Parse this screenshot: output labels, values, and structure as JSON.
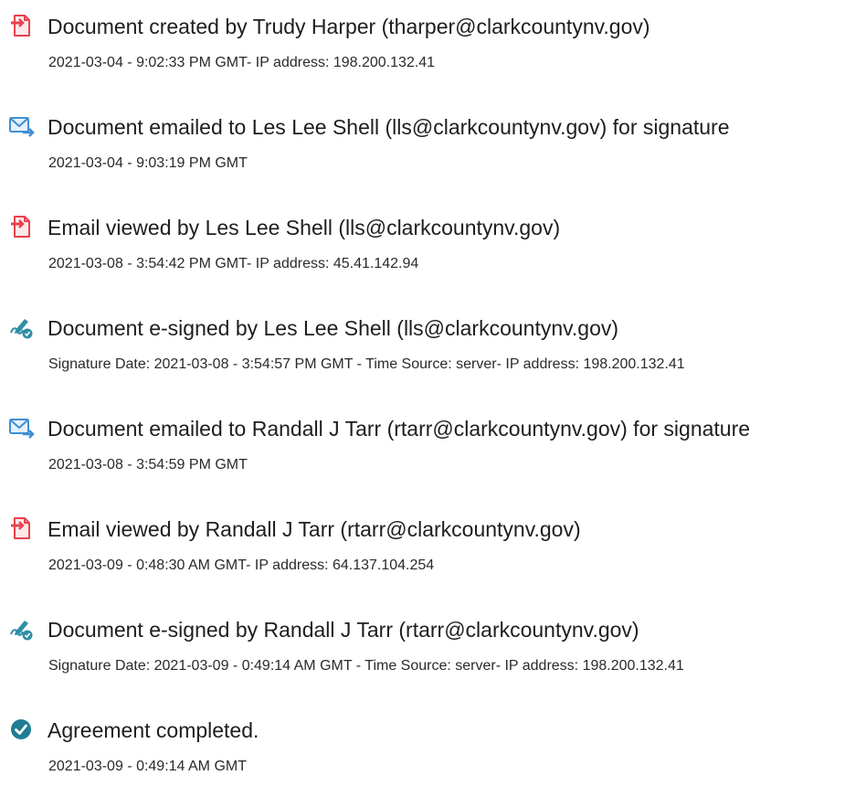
{
  "events": [
    {
      "icon": "document-icon",
      "title": "Document created by Trudy Harper (tharper@clarkcountynv.gov)",
      "detail": "2021-03-04 - 9:02:33 PM GMT- IP address: 198.200.132.41"
    },
    {
      "icon": "email-icon",
      "title": "Document emailed to Les Lee Shell (lls@clarkcountynv.gov) for signature",
      "detail": "2021-03-04 - 9:03:19 PM GMT"
    },
    {
      "icon": "document-icon",
      "title": "Email viewed by Les Lee Shell (lls@clarkcountynv.gov)",
      "detail": "2021-03-08 - 3:54:42 PM GMT- IP address: 45.41.142.94"
    },
    {
      "icon": "pen-icon",
      "title": "Document e-signed by Les Lee Shell (lls@clarkcountynv.gov)",
      "detail": "Signature Date: 2021-03-08 - 3:54:57 PM GMT - Time Source: server- IP address: 198.200.132.41"
    },
    {
      "icon": "email-icon",
      "title": "Document emailed to Randall J Tarr (rtarr@clarkcountynv.gov) for signature",
      "detail": "2021-03-08 - 3:54:59 PM GMT"
    },
    {
      "icon": "document-icon",
      "title": "Email viewed by Randall J Tarr (rtarr@clarkcountynv.gov)",
      "detail": "2021-03-09 - 0:48:30 AM GMT- IP address: 64.137.104.254"
    },
    {
      "icon": "pen-icon",
      "title": "Document e-signed by Randall J Tarr (rtarr@clarkcountynv.gov)",
      "detail": "Signature Date: 2021-03-09 - 0:49:14 AM GMT - Time Source: server- IP address: 198.200.132.41"
    },
    {
      "icon": "check-circle-icon",
      "title": "Agreement completed.",
      "detail": "2021-03-09 - 0:49:14 AM GMT"
    }
  ],
  "colors": {
    "document_icon": "#e8414d",
    "email_icon": "#3e8fd4",
    "pen_icon": "#2f8fa6",
    "check_icon": "#1f7c93"
  }
}
